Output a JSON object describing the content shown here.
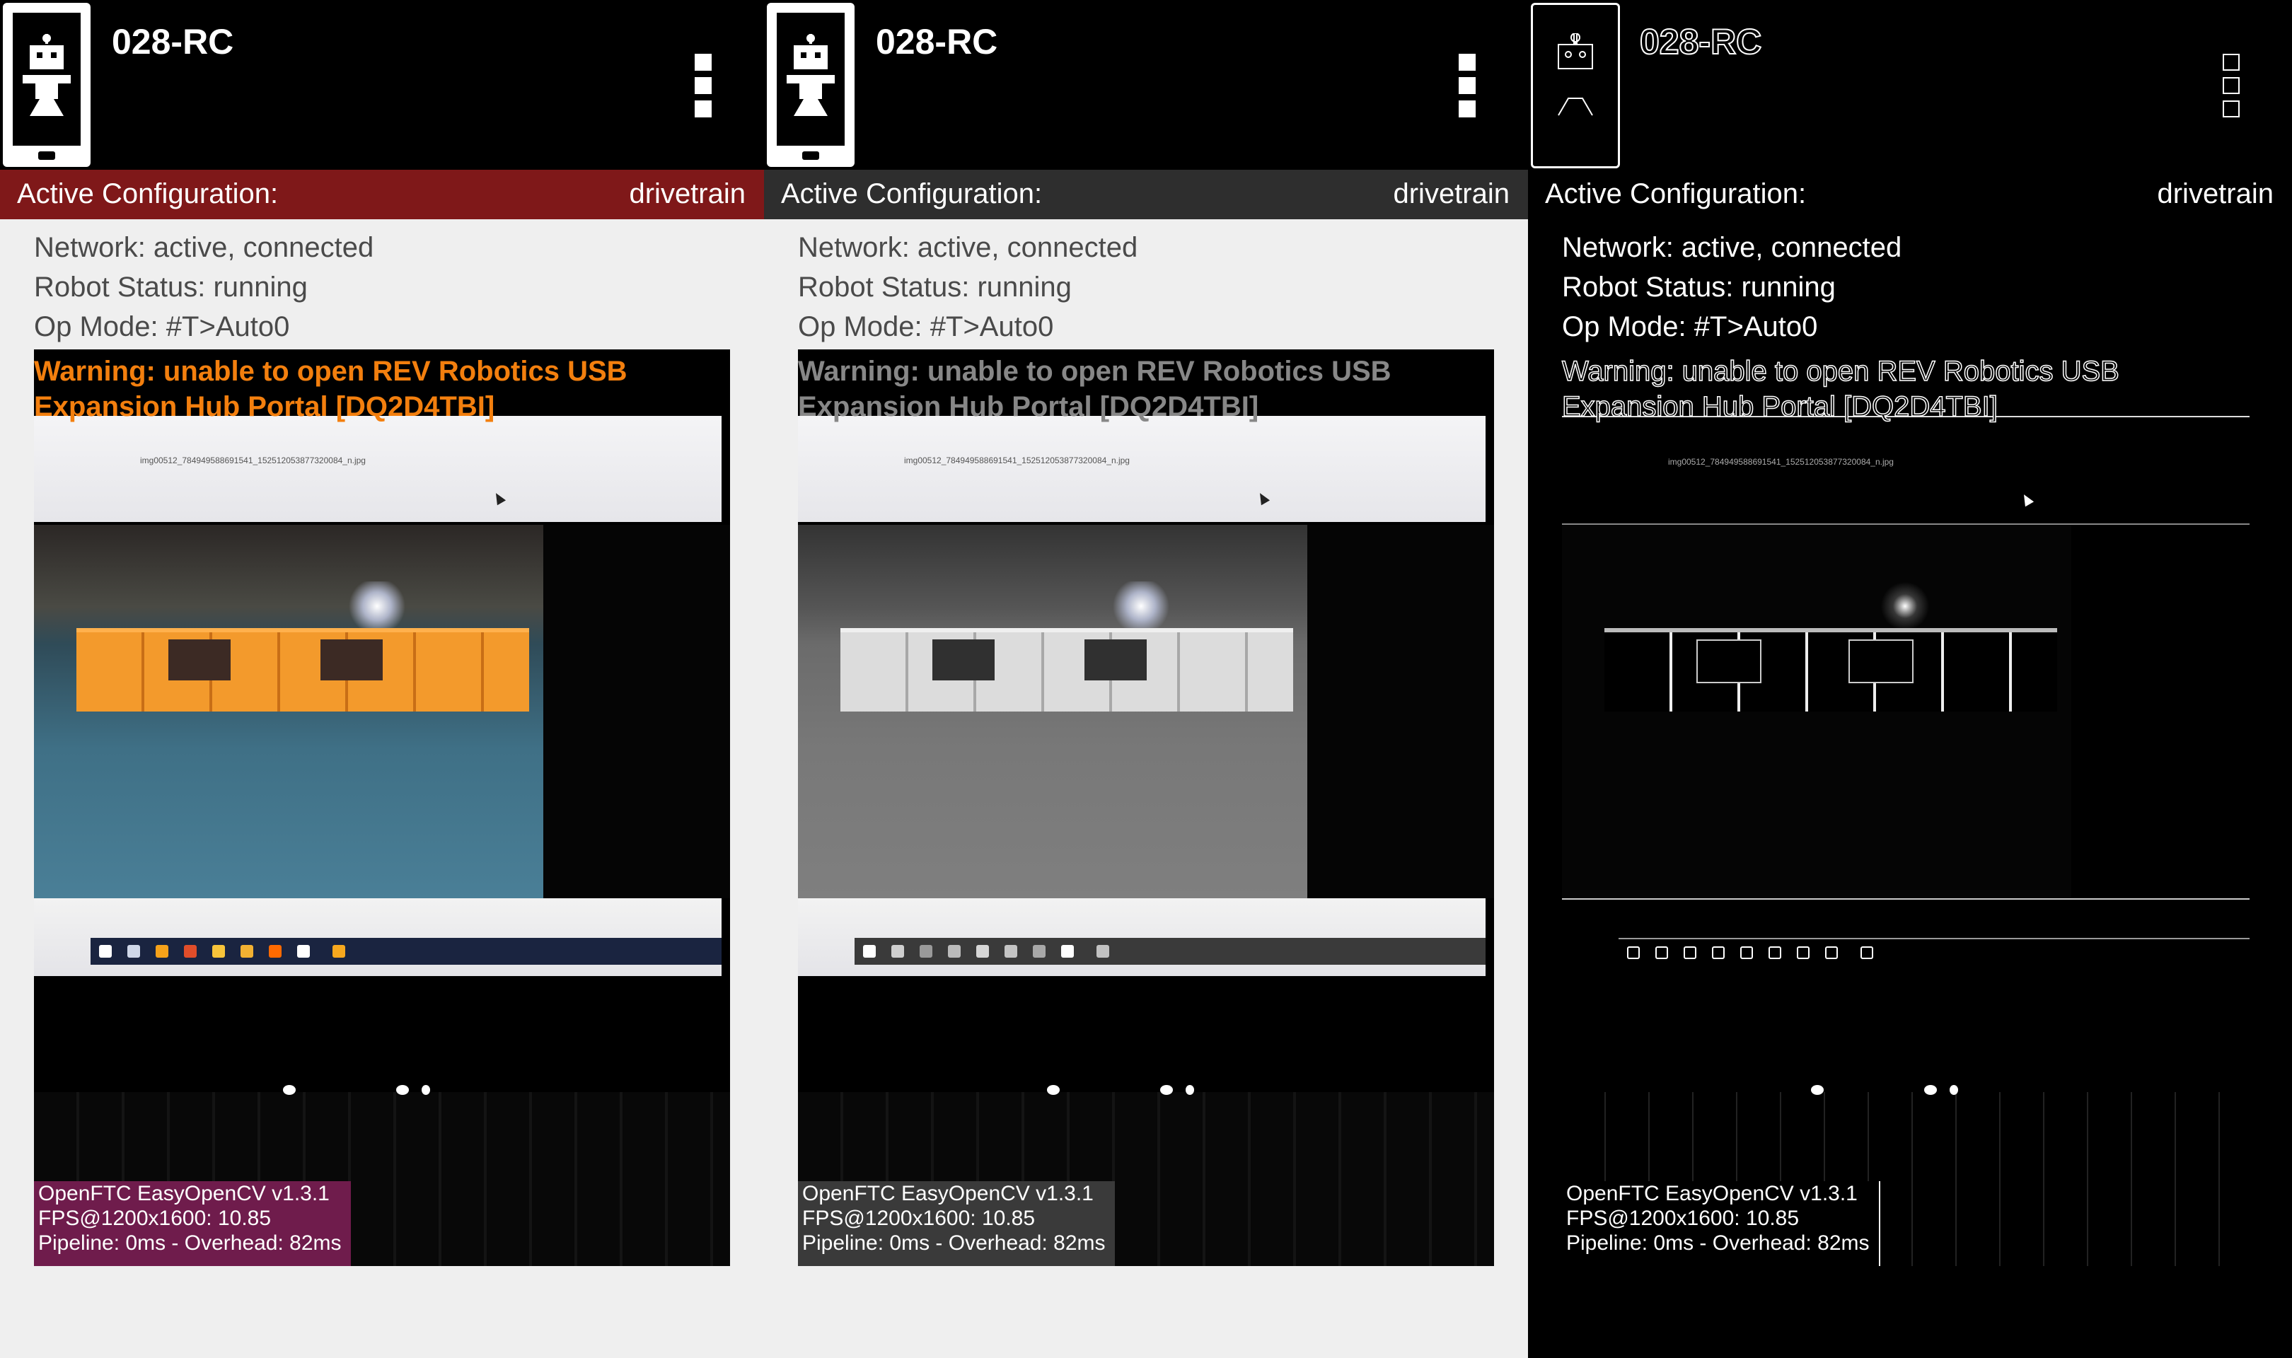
{
  "colors": {
    "config_bar_default": "#7f1819",
    "config_bar_grayscale": "#2e2e2e",
    "config_bar_edges": "#000000",
    "warning_default": "#f37f0e",
    "warning_grayscale": "#878787",
    "warning_edges": "#ffffff",
    "overlay_default": "#6f1c4c",
    "overlay_grayscale": "#3a3a3a",
    "overlay_edges": "#000000"
  },
  "panels": [
    {
      "app_title": "028-RC",
      "icons": {
        "logo": "robot-phone-icon",
        "menu": "overflow-menu-icon"
      },
      "config_label": "Active Configuration:",
      "config_value": "drivetrain",
      "network": "Network: active, connected",
      "robot_status": "Robot Status: running",
      "op_mode": "Op Mode: #T>Auto0",
      "warning_line1": "Warning: unable to open REV Robotics USB",
      "warning_line2": "Expansion Hub Portal [DQ2D4TBI]",
      "overlay_line1": "OpenFTC EasyOpenCV v1.3.1",
      "overlay_line2": "FPS@1200x1600: 10.85",
      "overlay_line3": "Pipeline: 0ms - Overhead: 82ms"
    },
    {
      "app_title": "028-RC",
      "icons": {
        "logo": "robot-phone-icon",
        "menu": "overflow-menu-icon"
      },
      "config_label": "Active Configuration:",
      "config_value": "drivetrain",
      "network": "Network: active, connected",
      "robot_status": "Robot Status: running",
      "op_mode": "Op Mode: #T>Auto0",
      "warning_line1": "Warning: unable to open REV Robotics USB",
      "warning_line2": "Expansion Hub Portal [DQ2D4TBI]",
      "overlay_line1": "OpenFTC EasyOpenCV v1.3.1",
      "overlay_line2": "FPS@1200x1600: 10.85",
      "overlay_line3": "Pipeline: 0ms - Overhead: 82ms"
    },
    {
      "app_title": "028-RC",
      "icons": {
        "logo": "robot-phone-icon",
        "menu": "overflow-menu-icon"
      },
      "config_label": "Active Configuration:",
      "config_value": "drivetrain",
      "network": "Network: active, connected",
      "robot_status": "Robot Status: running",
      "op_mode": "Op Mode: #T>Auto0",
      "warning_line1": "Warning: unable to open REV Robotics USB",
      "warning_line2": "Expansion Hub Portal [DQ2D4TBI]",
      "overlay_line1": "OpenFTC EasyOpenCV v1.3.1",
      "overlay_line2": "FPS@1200x1600: 10.85",
      "overlay_line3": "Pipeline: 0ms - Overhead: 82ms"
    }
  ]
}
